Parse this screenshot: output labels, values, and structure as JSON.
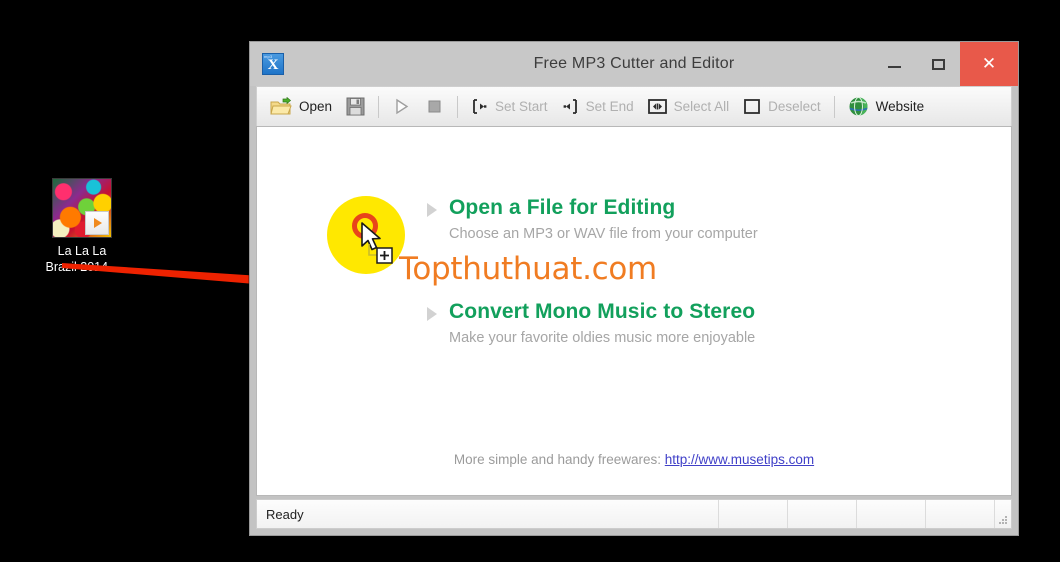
{
  "desktop": {
    "icon": {
      "name": "desktop-icon-la-la-la",
      "label": "La La La\nBrazil 2014...",
      "thumbnail_icon": "album-art-thumbnail",
      "badge_icon": "play-badge-icon"
    },
    "background_color": "#000000"
  },
  "annotation": {
    "arrow_icon": "red-pointer-arrow",
    "arrow_color": "#ee2200",
    "watermark": "Topthuthuat.com",
    "watermark_color": "#f07c22",
    "click_highlight_color": "#ffe800",
    "click_ring_color": "#e8441a",
    "cursor_icon": "arrow-cursor-with-drag-plus"
  },
  "window": {
    "title": "Free MP3 Cutter and Editor",
    "app_icon": "mp3-cutter-app-icon",
    "app_icon_letter": "X",
    "app_icon_sublabel": "mp3",
    "controls": {
      "minimize_label": "–",
      "minimize_icon": "minimize-icon",
      "maximize_label": "☐",
      "maximize_icon": "maximize-icon",
      "close_label": "✕",
      "close_icon": "close-icon",
      "close_color": "#e8594a"
    }
  },
  "toolbar": {
    "items": [
      {
        "label": "Open",
        "icon": "open-folder-icon",
        "disabled": false,
        "has_label": true
      },
      {
        "label": "",
        "icon": "save-floppy-icon",
        "disabled": false,
        "has_label": false
      },
      {
        "label": "",
        "icon": "play-icon",
        "disabled": true,
        "has_label": false
      },
      {
        "label": "",
        "icon": "stop-icon",
        "disabled": true,
        "has_label": false
      },
      {
        "label": "Set Start",
        "icon": "set-start-icon",
        "disabled": true,
        "has_label": true
      },
      {
        "label": "Set End",
        "icon": "set-end-icon",
        "disabled": true,
        "has_label": true
      },
      {
        "label": "Select All",
        "icon": "select-all-icon",
        "disabled": true,
        "has_label": true
      },
      {
        "label": "Deselect",
        "icon": "deselect-icon",
        "disabled": true,
        "has_label": true
      },
      {
        "label": "Website",
        "icon": "globe-website-icon",
        "disabled": false,
        "has_label": true
      }
    ]
  },
  "content": {
    "actions": [
      {
        "title": "Open a File for Editing",
        "subtitle": "Choose an MP3 or WAV file from your computer",
        "bullet_icon": "triangle-bullet-icon"
      },
      {
        "title": "Convert Mono Music to Stereo",
        "subtitle": "Make your favorite oldies music more enjoyable",
        "bullet_icon": "triangle-bullet-icon"
      }
    ],
    "footer_prefix": "More simple and handy freewares:",
    "footer_link": "http://www.musetips.com",
    "title_color": "#12a05c",
    "subtitle_color": "#a6a6a6",
    "link_color": "#4040c8"
  },
  "status_bar": {
    "message": "Ready",
    "resize_grip_icon": "resize-grip-icon"
  }
}
